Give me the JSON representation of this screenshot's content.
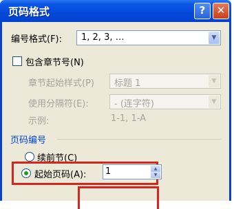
{
  "dialog": {
    "title": "页码格式",
    "help_glyph": "?",
    "close_glyph": "✕"
  },
  "number_format": {
    "label": "编号格式(F):",
    "value": "1, 2, 3, …"
  },
  "include_chapter": {
    "label": "包含章节号(N)",
    "checked": false
  },
  "chapter_style": {
    "label": "章节起始样式(P)",
    "value": "标题 1"
  },
  "separator": {
    "label": "使用分隔符(E):",
    "value": "-  (连字符)"
  },
  "example": {
    "label": "示例:",
    "value": "1-1, 1-A"
  },
  "page_numbering": {
    "group_title": "页码编号",
    "continue_label": "续前节(C)",
    "start_at_label": "起始页码(A):",
    "start_at_value": "1",
    "selected": "start_at"
  },
  "colors": {
    "highlight": "#d8241c",
    "title_bar": "#0447d8"
  },
  "icons": {
    "dropdown": "chevron-down-icon",
    "spin_up": "arrow-up-icon",
    "spin_down": "arrow-down-icon"
  }
}
